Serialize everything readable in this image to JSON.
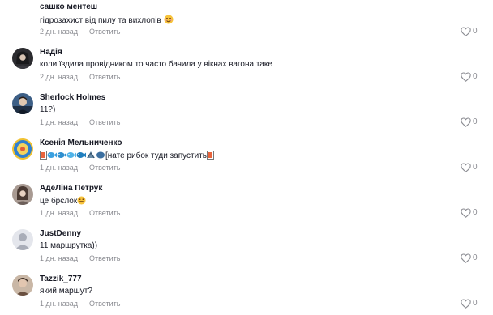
{
  "comments": [
    {
      "username": "сашко ментеш",
      "text": "гідрозахист від пилу та вихлопів",
      "date": "2 дн. назад",
      "reply": "Ответить",
      "likes": "0",
      "avatar_color": "#6f7b86"
    },
    {
      "username": "Надія",
      "text": "коли їздила провідником то часто бачила у вікнах вагона таке",
      "date": "2 дн. назад",
      "reply": "Ответить",
      "likes": "0",
      "avatar_color": "#2b2b2f"
    },
    {
      "username": "Sherlock Holmes",
      "text": "11?)",
      "date": "1 дн. назад",
      "reply": "Ответить",
      "likes": "0",
      "avatar_color": "#2f4a6a"
    },
    {
      "username": "Ксенія Мельниченко",
      "text": "[нате рибок туди запустить",
      "date": "1 дн. назад",
      "reply": "Ответить",
      "likes": "0",
      "avatar_color": "#d6a01c"
    },
    {
      "username": "АдеЛіна Петрук",
      "text": "це брєлок",
      "date": "1 дн. назад",
      "reply": "Ответить",
      "likes": "0",
      "avatar_color": "#8c7f7a"
    },
    {
      "username": "JustDenny",
      "text": "11 маршрутка))",
      "date": "1 дн. назад",
      "reply": "Ответить",
      "likes": "0",
      "avatar_color": "#b9bcc4"
    },
    {
      "username": "Tazzik_777",
      "text": "який маршут?",
      "date": "1 дн. назад",
      "reply": "Ответить",
      "likes": "0",
      "avatar_color": "#a58a78"
    }
  ]
}
